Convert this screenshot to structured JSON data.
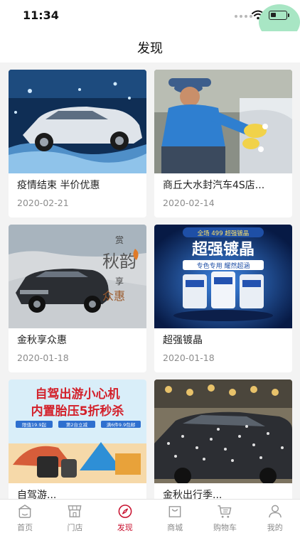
{
  "status_bar": {
    "time": "11:34"
  },
  "header": {
    "title": "发现"
  },
  "cards": [
    {
      "title": "疫情结束 半价优惠",
      "date": "2020-02-21"
    },
    {
      "title": "商丘大水封汽车4S店...",
      "date": "2020-02-14"
    },
    {
      "title": "金秋享众惠",
      "date": "2020-01-18",
      "image_text": {
        "line1": "赏",
        "line2": "秋韵",
        "line3": "享",
        "line4": "众惠"
      }
    },
    {
      "title": "超强镀晶",
      "date": "2020-01-18",
      "image_text": {
        "banner": "全场 499 超强镀晶",
        "headline": "超强镀晶",
        "sub": "专色专用 耀然超涵"
      }
    },
    {
      "title": "自驾游...",
      "date": "",
      "image_text": {
        "line1": "自驾出游小心机",
        "line2": "内置胎压5折秒杀",
        "tags": [
          "限值19.9起",
          "第2台立减",
          "满6件9.9包邮"
        ]
      }
    },
    {
      "title": "金秋出行季...",
      "date": ""
    }
  ],
  "tabbar": {
    "items": [
      {
        "label": "首页",
        "icon": "home-icon"
      },
      {
        "label": "门店",
        "icon": "store-icon"
      },
      {
        "label": "发现",
        "icon": "compass-icon",
        "active": true
      },
      {
        "label": "商城",
        "icon": "shopping-bag-icon"
      },
      {
        "label": "购物车",
        "icon": "cart-icon"
      },
      {
        "label": "我的",
        "icon": "user-icon"
      }
    ]
  },
  "colors": {
    "accent": "#c8102e",
    "inactive": "#8a8a8a",
    "background": "#f3f3f3"
  }
}
